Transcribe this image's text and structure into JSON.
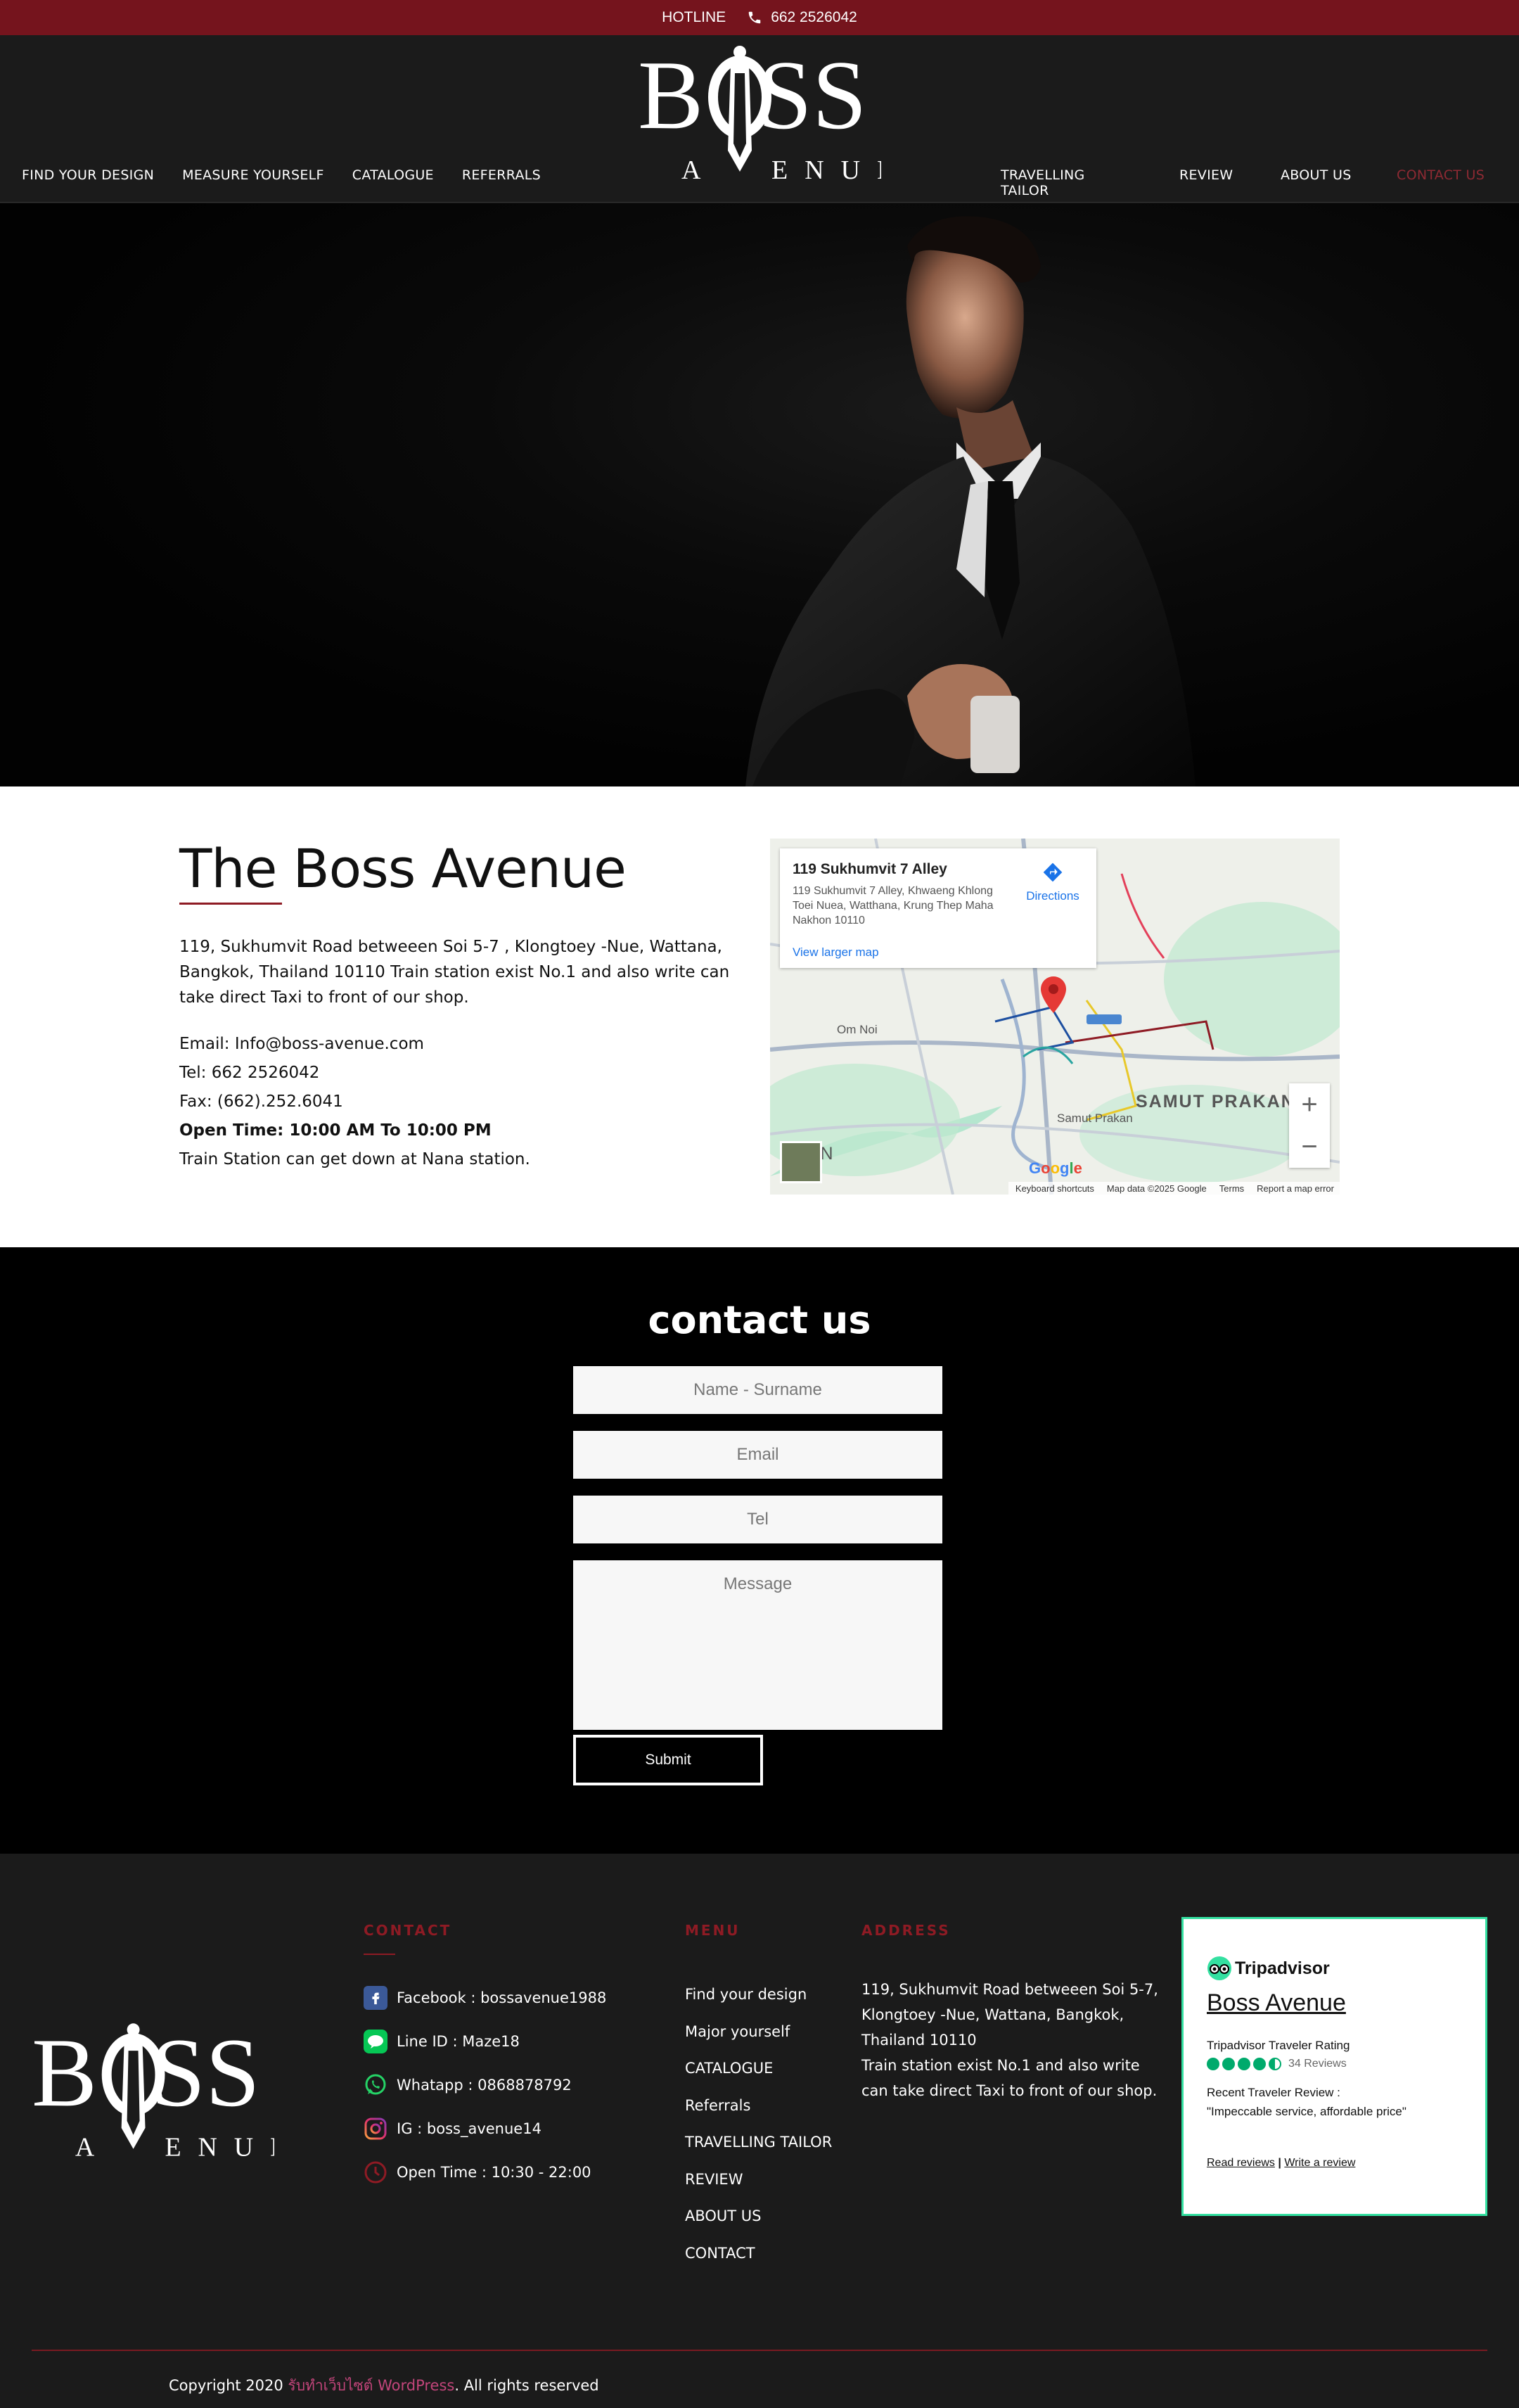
{
  "topbar": {
    "hotline_label": "HOTLINE",
    "phone": "662 2526042"
  },
  "header": {
    "logo_text": "BOSS",
    "logo_sub": "AVENUE",
    "nav_left": [
      "FIND YOUR DESIGN",
      "MEASURE YOURSELF",
      "CATALOGUE",
      "REFERRALS"
    ],
    "nav_right": [
      "TRAVELLING TAILOR",
      "REVIEW",
      "ABOUT US",
      "CONTACT US"
    ],
    "active_color": "#8e2a33"
  },
  "about": {
    "title": "The Boss Avenue",
    "address": "119, Sukhumvit Road betweeen Soi 5-7 , Klongtoey -Nue, Wattana, Bangkok, Thailand 10110 Train station exist No.1 and also write can take direct Taxi to front of our shop.",
    "email": "Email: Info@boss-avenue.com",
    "tel": "Tel: 662 2526042",
    "fax": "Fax: (662).252.6041",
    "open_time": "Open Time: 10:00 AM To 10:00 PM",
    "station": "Train Station can get down at Nana station."
  },
  "map": {
    "place_title": "119 Sukhumvit 7 Alley",
    "place_address": "119 Sukhumvit 7 Alley, Khwaeng Khlong Toei Nuea, Watthana, Krung Thep Maha Nakhon 10110",
    "directions": "Directions",
    "larger_map": "View larger map",
    "region_label": "SAMUT PRAKAN",
    "region_label2": "HON",
    "om_noi": "Om Noi",
    "samut_small": "Samut Prakan",
    "footer_items": [
      "Keyboard shortcuts",
      "Map data ©2025 Google",
      "Terms",
      "Report a map error"
    ],
    "zoom_in": "+",
    "zoom_out": "−",
    "google": "Google"
  },
  "contact": {
    "title": "contact us",
    "name_placeholder": "Name - Surname",
    "email_placeholder": "Email",
    "tel_placeholder": "Tel",
    "message_placeholder": "Message",
    "submit": "Submit"
  },
  "footer": {
    "contact_heading": "CONTACT",
    "menu_heading": "MENU",
    "address_heading": "ADDRESS",
    "contacts": [
      {
        "icon": "facebook-icon",
        "text": "Facebook : bossavenue1988"
      },
      {
        "icon": "line-icon",
        "text": "Line ID : Maze18"
      },
      {
        "icon": "whatsapp-icon",
        "text": "Whatapp : 0868878792"
      },
      {
        "icon": "instagram-icon",
        "text": "IG : boss_avenue14"
      },
      {
        "icon": "clock-icon",
        "text": "Open Time : 10:30 - 22:00"
      }
    ],
    "menu": [
      "Find your design",
      "Major yourself",
      "CATALOGUE",
      "Referrals",
      "TRAVELLING TAILOR",
      "REVIEW",
      "ABOUT US",
      "CONTACT"
    ],
    "address": "119, Sukhumvit Road betweeen Soi 5-7, Klongtoey -Nue, Wattana, Bangkok, Thailand 10110\nTrain station exist No.1 and also write can take direct Taxi to front of our shop.",
    "tripadvisor": {
      "brand": "Tripadvisor",
      "name": "Boss Avenue",
      "rating_label": "Tripadvisor Traveler Rating",
      "reviews": "34 Reviews",
      "recent": "Recent Traveler Review :",
      "quote": "\"Impeccable service, affordable price\"",
      "read": "Read reviews",
      "sep": "|",
      "write": "Write a review",
      "rating": 4.5
    },
    "copyright_prefix": "Copyright 2020",
    "copyright_link": "รับทำเว็บไซต์ WordPress",
    "copyright_suffix": ". All rights reserved"
  }
}
